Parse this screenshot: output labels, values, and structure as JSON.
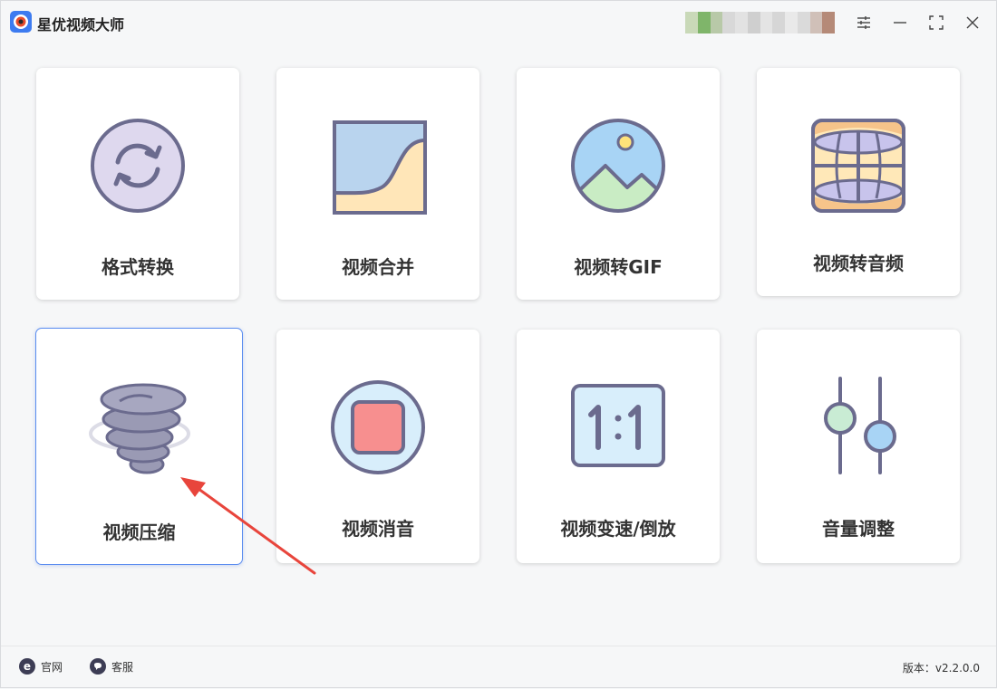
{
  "app": {
    "title": "星优视频大师"
  },
  "tiles": [
    {
      "label": "格式转换",
      "icon": "convert-icon"
    },
    {
      "label": "视频合并",
      "icon": "merge-icon"
    },
    {
      "label": "视频转GIF",
      "icon": "gif-image-icon"
    },
    {
      "label": "视频转音频",
      "icon": "audio-globe-icon"
    },
    {
      "label": "视频压缩",
      "icon": "tornado-compress-icon",
      "selected": true
    },
    {
      "label": "视频消音",
      "icon": "stop-mute-icon"
    },
    {
      "label": "视频变速/倒放",
      "icon": "ratio-1-1-icon"
    },
    {
      "label": "音量调整",
      "icon": "sliders-icon"
    }
  ],
  "footer": {
    "website_label": "官网",
    "support_label": "客服",
    "version_text": "版本：v2.2.0.0"
  },
  "colors": {
    "accent": "#5a8cf0",
    "arrow": "#e8453c",
    "icon_stroke": "#6b6b8e"
  }
}
